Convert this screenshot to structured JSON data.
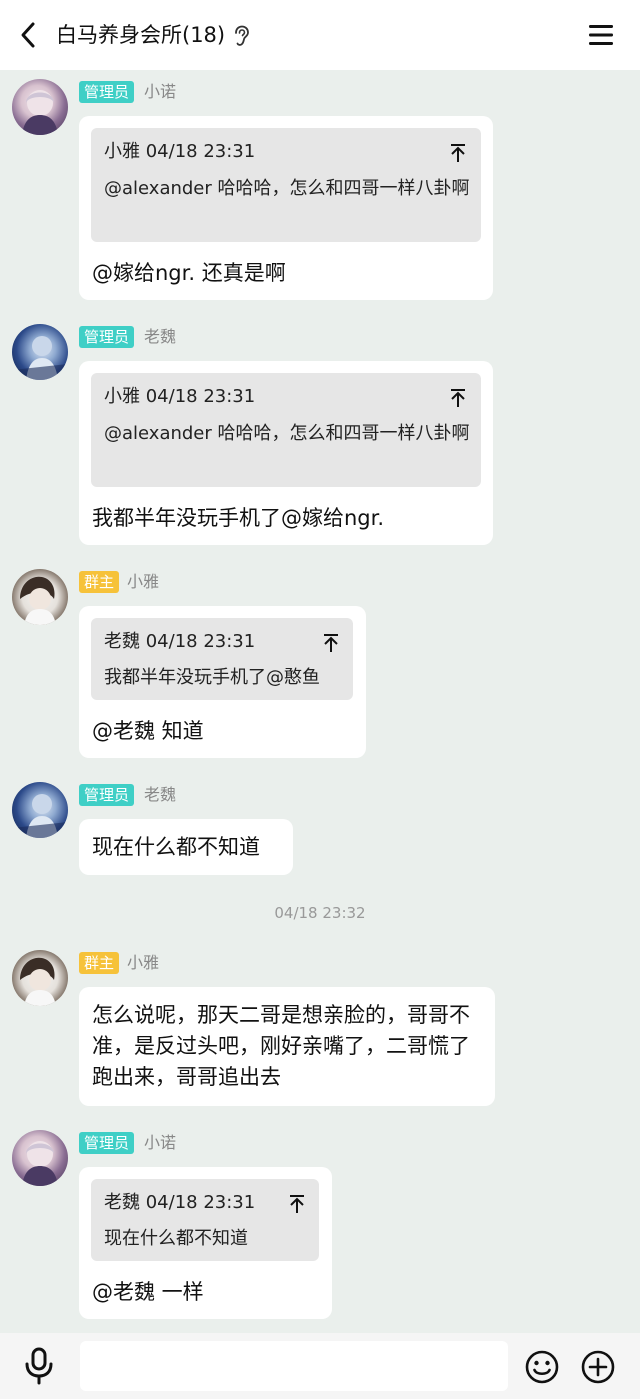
{
  "header": {
    "title": "白马养身会所(18)",
    "back_icon": "chevron-left-icon",
    "ear_icon": "ear-icon",
    "menu_icon": "menu-icon"
  },
  "messages": [
    {
      "role": "管理员",
      "nick": "小诺",
      "quote": {
        "head": "小雅 04/18 23:31",
        "body": "@alexander 哈哈哈，怎么和四哥一样八卦啊"
      },
      "text": "@嫁给ngr. 还真是啊"
    },
    {
      "role": "管理员",
      "nick": "老魏",
      "quote": {
        "head": "小雅 04/18 23:31",
        "body": "@alexander 哈哈哈，怎么和四哥一样八卦啊"
      },
      "text": "我都半年没玩手机了@嫁给ngr."
    },
    {
      "role": "群主",
      "nick": "小雅",
      "quote": {
        "head": "老魏 04/18 23:31",
        "body": "我都半年没玩手机了@憨鱼"
      },
      "text": "@老魏 知道"
    },
    {
      "role": "管理员",
      "nick": "老魏",
      "text": "现在什么都不知道"
    },
    {
      "role": "群主",
      "nick": "小雅",
      "text": "怎么说呢，那天二哥是想亲脸的，哥哥不准，是反过头吧，刚好亲嘴了，二哥慌了跑出来，哥哥追出去"
    },
    {
      "role": "管理员",
      "nick": "小诺",
      "quote": {
        "head": "老魏 04/18 23:31",
        "body": "现在什么都不知道"
      },
      "text": "@老魏 一样"
    }
  ],
  "time_separator": "04/18 23:32",
  "input_bar": {
    "placeholder": "",
    "voice_icon": "microphone-icon",
    "emoji_icon": "emoji-icon",
    "plus_icon": "plus-icon"
  },
  "colors": {
    "background": "#eaefec",
    "admin_badge": "#3fcfc6",
    "owner_badge": "#f6c23a",
    "bubble": "#ffffff",
    "quote": "#e6e6e6"
  }
}
